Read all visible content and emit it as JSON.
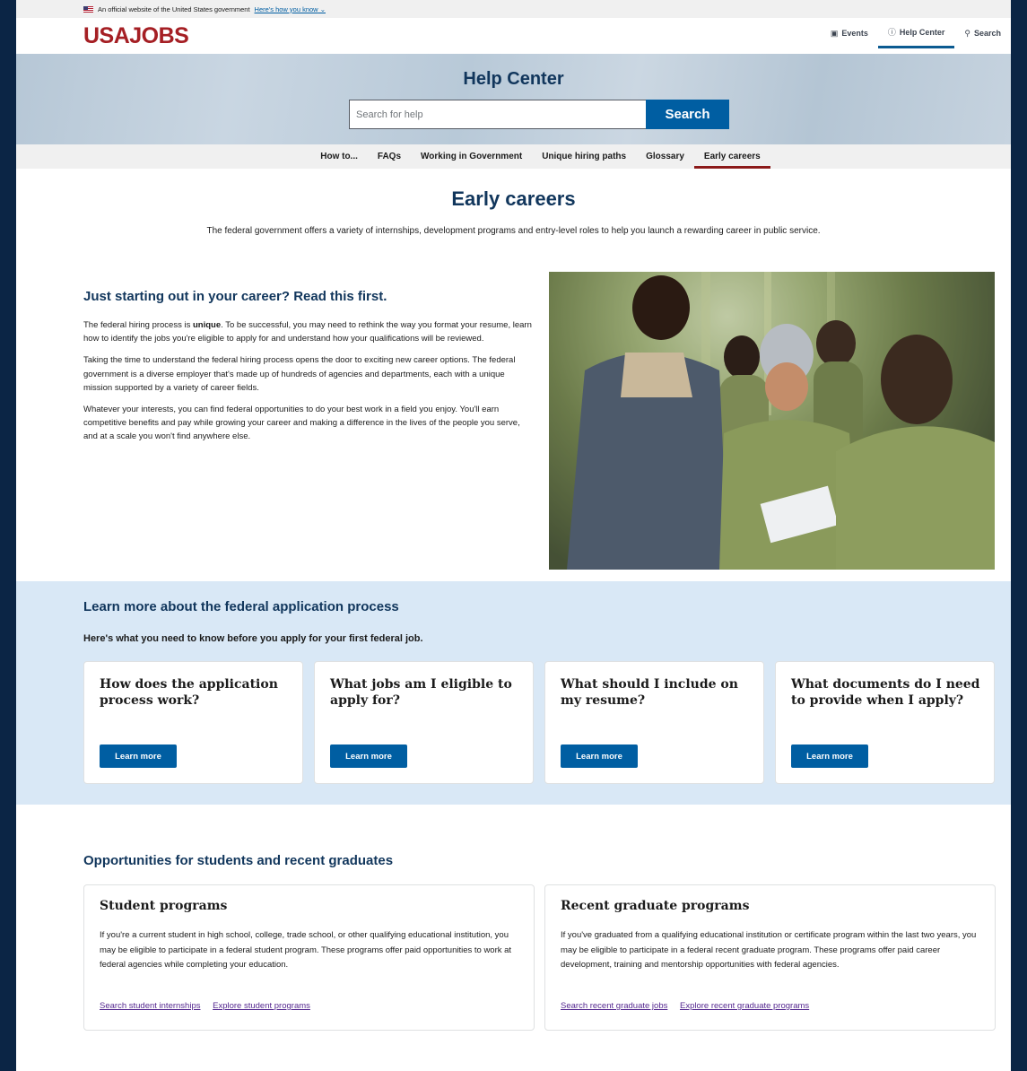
{
  "gov_banner": {
    "text": "An official website of the United States government",
    "link": "Here's how you know"
  },
  "header": {
    "logo": "USAJOBS",
    "nav": [
      {
        "label": "Events",
        "icon": "calendar-icon",
        "glyph": "▣"
      },
      {
        "label": "Help Center",
        "icon": "help-icon",
        "glyph": "ⓘ"
      },
      {
        "label": "Search",
        "icon": "search-icon",
        "glyph": "⚲"
      }
    ]
  },
  "hero": {
    "title": "Help Center",
    "search_placeholder": "Search for help",
    "search_button": "Search"
  },
  "subnav": [
    "How to...",
    "FAQs",
    "Working in Government",
    "Unique hiring paths",
    "Glossary",
    "Early careers"
  ],
  "page": {
    "title": "Early careers",
    "lead": "The federal government offers a variety of internships, development programs and entry-level roles to help you launch a rewarding career in public service."
  },
  "intro": {
    "heading": "Just starting out in your career? Read this first.",
    "p1_before": "The federal hiring process is ",
    "p1_bold": "unique",
    "p1_after": ". To be successful, you may need to rethink the way you format your resume, learn how to identify the jobs you're eligible to apply for and understand how your qualifications will be reviewed.",
    "p2": "Taking the time to understand the federal hiring process opens the door to exciting new career options. The federal government is a diverse employer that's made up of hundreds of agencies and departments, each with a unique mission supported by a variety of career fields.",
    "p3": "Whatever your interests, you can find federal opportunities to do your best work in a field you enjoy. You'll earn competitive benefits and pay while growing your career and making a difference in the lives of the people you serve, and at a scale you won't find anywhere else."
  },
  "learn": {
    "heading": "Learn more about the federal application process",
    "subheading": "Here's what you need to know before you apply for your first federal job.",
    "cards": [
      {
        "title": "How does the application process work?",
        "button": "Learn more"
      },
      {
        "title": "What jobs am I eligible to apply for?",
        "button": "Learn more"
      },
      {
        "title": "What should I include on my resume?",
        "button": "Learn more"
      },
      {
        "title": "What documents do I need to provide when I apply?",
        "button": "Learn more"
      }
    ]
  },
  "opportunities": {
    "heading": "Opportunities for students and recent graduates",
    "student": {
      "title": "Student programs",
      "body": "If you're a current student in high school, college, trade school, or other qualifying educational institution, you may be eligible to participate in a federal student program. These programs offer paid opportunities to work at federal agencies while completing your education.",
      "link1": "Search student internships",
      "link2": "Explore student programs"
    },
    "graduate": {
      "title": "Recent graduate programs",
      "body": "If you've graduated from a qualifying educational institution or certificate program within the last two years, you may be eligible to participate in a federal recent graduate program. These programs offer paid career development, training and mentorship opportunities with federal agencies.",
      "link1": "Search recent graduate jobs",
      "link2": "Explore recent graduate programs"
    }
  },
  "colors": {
    "brand_red": "#a51f24",
    "primary_blue": "#005ea2",
    "heading_navy": "#11365c",
    "section_bg": "#d9e8f6",
    "visited_link": "#54278f"
  }
}
